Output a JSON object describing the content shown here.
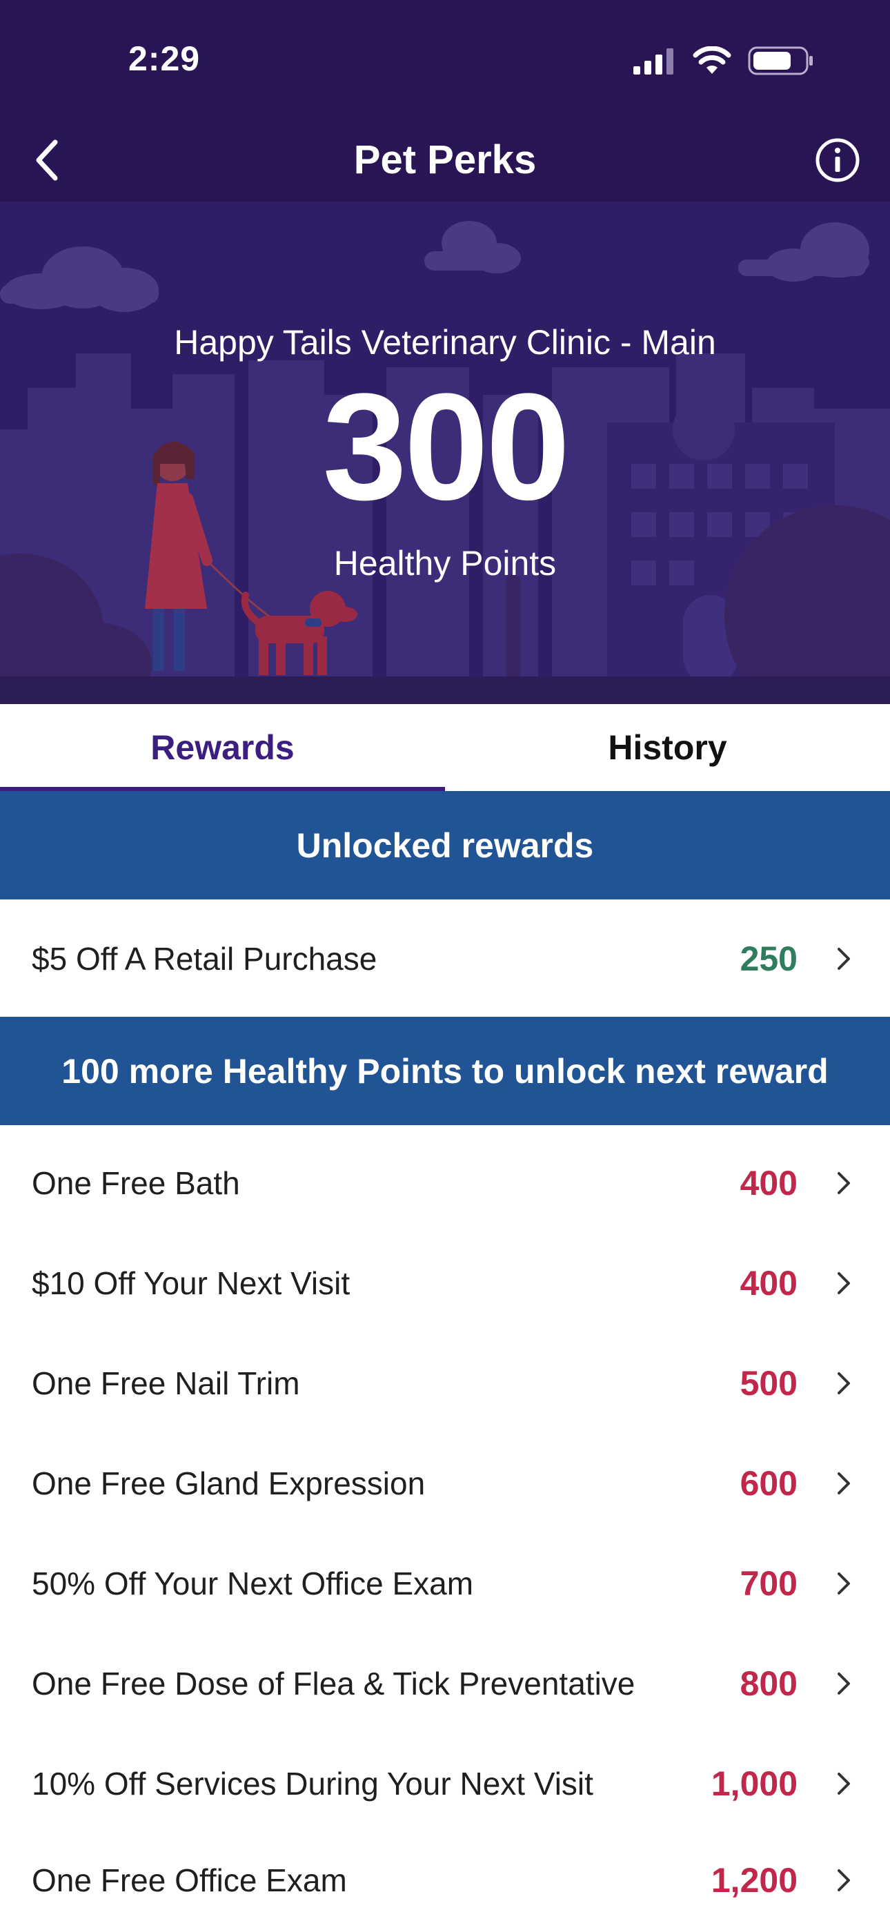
{
  "status_bar": {
    "time": "2:29"
  },
  "nav": {
    "title": "Pet Perks",
    "back_icon": "chevron-left-icon",
    "info_icon": "info-icon"
  },
  "hero": {
    "clinic_name": "Happy Tails Veterinary Clinic - Main",
    "points_value": "300",
    "points_label": "Healthy Points"
  },
  "tabs": [
    {
      "label": "Rewards",
      "active": true
    },
    {
      "label": "History",
      "active": false
    }
  ],
  "unlocked_section": {
    "header": "Unlocked rewards",
    "items": [
      {
        "label": "$5 Off A Retail Purchase",
        "points": "250"
      }
    ]
  },
  "locked_section": {
    "header": "100 more Healthy Points to unlock next reward",
    "items": [
      {
        "label": "One Free Bath",
        "points": "400"
      },
      {
        "label": "$10 Off Your Next Visit",
        "points": "400"
      },
      {
        "label": "One Free Nail Trim",
        "points": "500"
      },
      {
        "label": "One Free Gland Expression",
        "points": "600"
      },
      {
        "label": "50% Off Your Next Office Exam",
        "points": "700"
      },
      {
        "label": "One Free Dose of Flea & Tick Preventative",
        "points": "800"
      },
      {
        "label": "10% Off Services During Your Next Visit",
        "points": "1,000"
      },
      {
        "label": "One Free Office Exam",
        "points": "1,200"
      }
    ]
  },
  "colors": {
    "header_bg": "#2a1554",
    "hero_bg": "#2f1e65",
    "section_bg": "#205494",
    "unlocked_points": "#2e7d5d",
    "locked_points": "#c0274a",
    "active_tab": "#3c1d80"
  }
}
